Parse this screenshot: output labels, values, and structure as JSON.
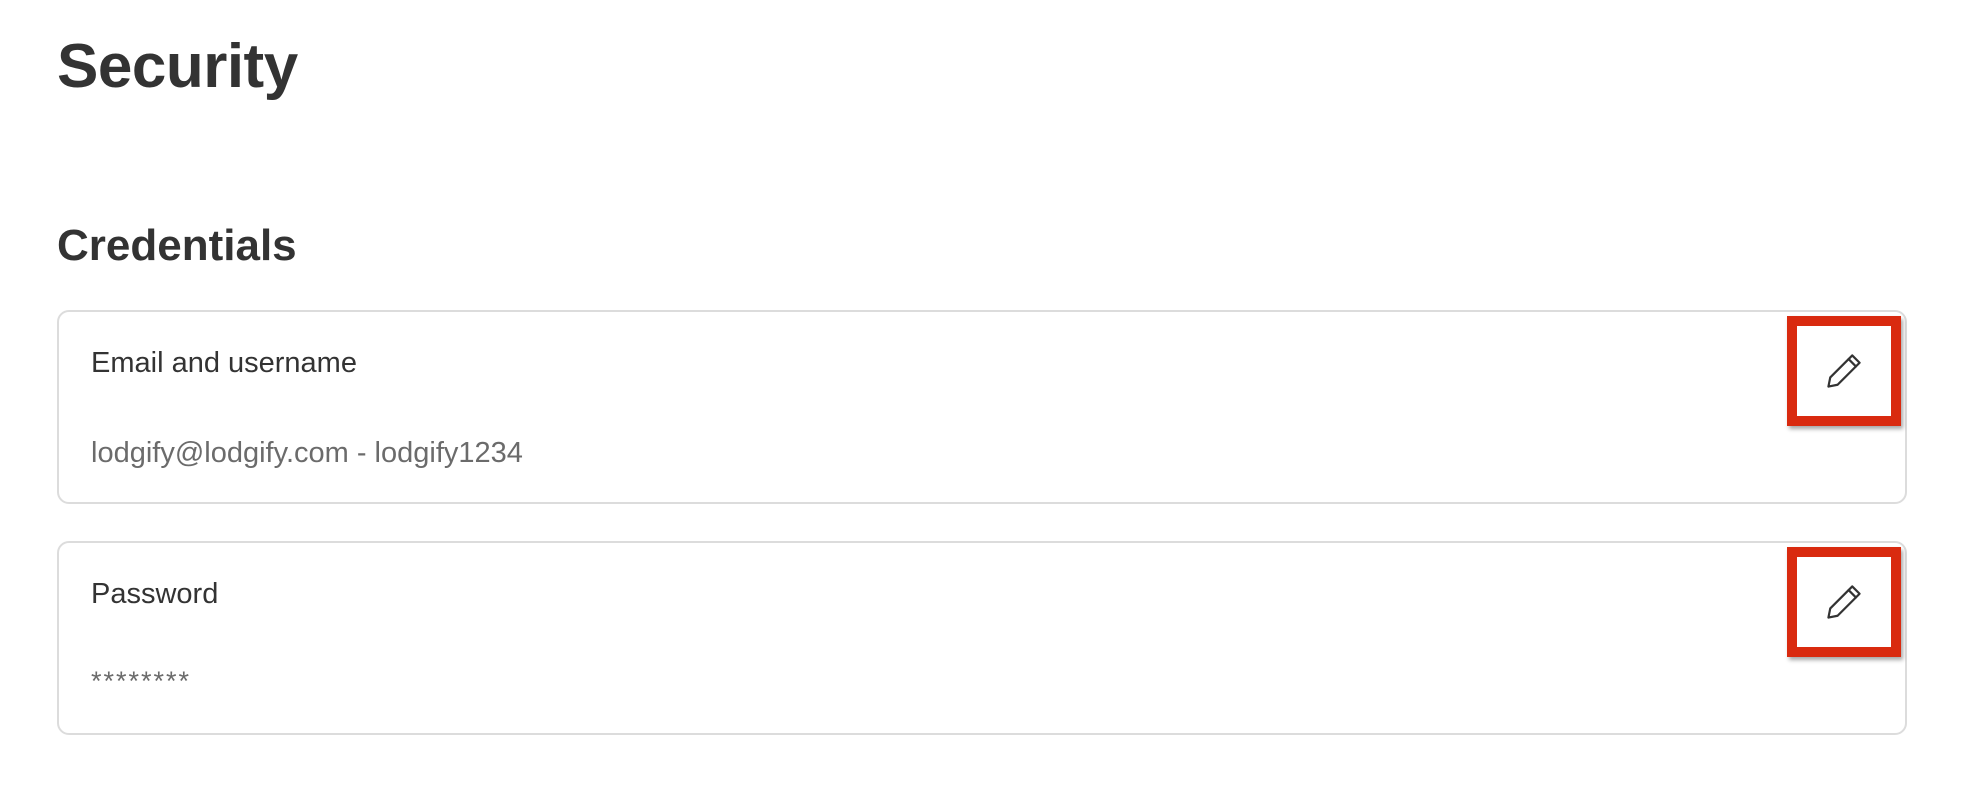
{
  "page": {
    "title": "Security"
  },
  "credentials": {
    "section_title": "Credentials",
    "email_card": {
      "label": "Email and username",
      "value": "lodgify@lodgify.com - lodgify1234",
      "edit_icon": "pencil-icon"
    },
    "password_card": {
      "label": "Password",
      "value": "********",
      "edit_icon": "pencil-icon"
    }
  },
  "colors": {
    "highlight": "#d92a0f",
    "text_primary": "#333333",
    "text_secondary": "#6b6b6b",
    "card_border": "#dcdcdc"
  }
}
